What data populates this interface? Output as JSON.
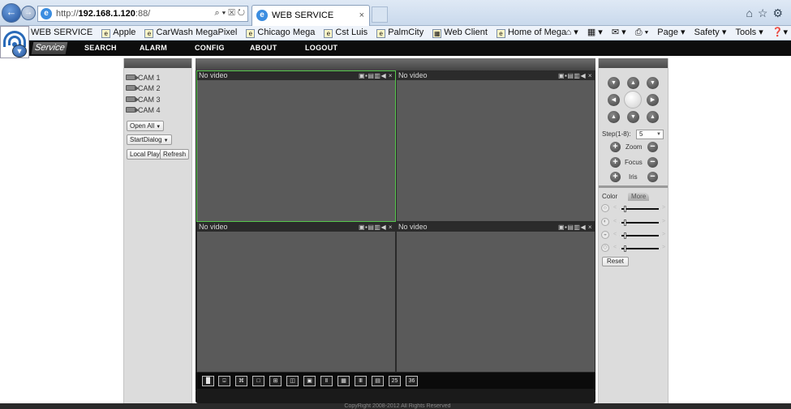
{
  "browser": {
    "url_prefix": "http://",
    "url_host": "192.168.1.120",
    "url_rest": ":88/",
    "url_tools": "⌕ ▾ ☒ ↻",
    "tab_title": "WEB SERVICE",
    "tab_close": "×",
    "right_icons": "⌂☆⚙",
    "favorites": [
      {
        "label": "WEB SERVICE"
      },
      {
        "label": "Apple"
      },
      {
        "label": "CarWash MegaPixel"
      },
      {
        "label": "Chicago Mega"
      },
      {
        "label": "Cst Luis"
      },
      {
        "label": "PalmCity"
      },
      {
        "label": "Web Client"
      },
      {
        "label": "Home of Mega"
      }
    ],
    "commands": [
      {
        "label": "⌂ ▾"
      },
      {
        "label": "▦ ▾"
      },
      {
        "label": "✉ ▾"
      },
      {
        "label": "⎙ ▾"
      },
      {
        "label": "Page ▾"
      },
      {
        "label": "Safety ▾"
      },
      {
        "label": "Tools ▾"
      },
      {
        "label": "❓▾"
      }
    ]
  },
  "app_nav": {
    "service_label": "Service",
    "items": [
      "SEARCH",
      "ALARM",
      "CONFIG",
      "ABOUT",
      "LOGOUT"
    ]
  },
  "left_panel": {
    "cameras": [
      "CAM 1",
      "CAM 2",
      "CAM 3",
      "CAM 4"
    ],
    "open_all": "Open All",
    "start_dialog": "StartDialog",
    "local_play": "Local Play",
    "refresh": "Refresh"
  },
  "video": {
    "cells": [
      {
        "label": "No video",
        "selected": true
      },
      {
        "label": "No video",
        "selected": false
      },
      {
        "label": "No video",
        "selected": false
      },
      {
        "label": "No video",
        "selected": false
      }
    ],
    "tool_icons": "▣▪▤▥◀ ×",
    "layouts": [
      "▐▌",
      "⌹",
      "⌘",
      "□",
      "⊞",
      "◫",
      "▣",
      "Ⅱ",
      "▦",
      "Ⅲ",
      "▤",
      "25",
      "36"
    ]
  },
  "ptz": {
    "arrows": [
      "▼",
      "▲",
      "▼",
      "◀",
      "▶",
      "▲",
      "▼",
      "▲"
    ],
    "step_label": "Step(1-8):",
    "step_value": "5",
    "zoom": "Zoom",
    "focus": "Focus",
    "iris": "Iris",
    "plus": "+",
    "minus": "−"
  },
  "color_panel": {
    "tab_color": "Color",
    "tab_more": "More",
    "slider_icons": [
      "☼",
      "◐",
      "◒",
      "◇"
    ],
    "reset": "Reset"
  },
  "footer": {
    "copyright": "CopyRight 2008-2012 All Rights Reserved"
  }
}
